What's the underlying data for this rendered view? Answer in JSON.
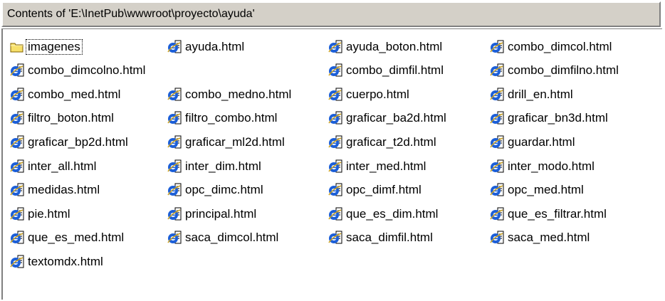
{
  "header": {
    "title": "Contents of 'E:\\InetPub\\wwwroot\\proyecto\\ayuda'"
  },
  "colors": {
    "ie_icon_blue": "#1c5fd8",
    "folder_yellow": "#f7e06a"
  },
  "files": [
    {
      "name": "imagenes",
      "icon": "folder-icon",
      "selected": true
    },
    {
      "name": "ayuda.html",
      "icon": "ie-html-icon"
    },
    {
      "name": "ayuda_boton.html",
      "icon": "ie-html-icon"
    },
    {
      "name": "combo_dimcol.html",
      "icon": "ie-html-icon"
    },
    {
      "name": "combo_dimcolno.html",
      "icon": "ie-html-icon"
    },
    {
      "name": "combo_dimfil.html",
      "icon": "ie-html-icon"
    },
    {
      "name": "combo_dimfilno.html",
      "icon": "ie-html-icon"
    },
    {
      "name": "combo_med.html",
      "icon": "ie-html-icon"
    },
    {
      "name": "combo_medno.html",
      "icon": "ie-html-icon"
    },
    {
      "name": "cuerpo.html",
      "icon": "ie-html-icon"
    },
    {
      "name": "drill_en.html",
      "icon": "ie-html-icon"
    },
    {
      "name": "filtro_boton.html",
      "icon": "ie-html-icon"
    },
    {
      "name": "filtro_combo.html",
      "icon": "ie-html-icon"
    },
    {
      "name": "graficar_ba2d.html",
      "icon": "ie-html-icon"
    },
    {
      "name": "graficar_bn3d.html",
      "icon": "ie-html-icon"
    },
    {
      "name": "graficar_bp2d.html",
      "icon": "ie-html-icon"
    },
    {
      "name": "graficar_ml2d.html",
      "icon": "ie-html-icon"
    },
    {
      "name": "graficar_t2d.html",
      "icon": "ie-html-icon"
    },
    {
      "name": "guardar.html",
      "icon": "ie-html-icon"
    },
    {
      "name": "inter_all.html",
      "icon": "ie-html-icon"
    },
    {
      "name": "inter_dim.html",
      "icon": "ie-html-icon"
    },
    {
      "name": "inter_med.html",
      "icon": "ie-html-icon"
    },
    {
      "name": "inter_modo.html",
      "icon": "ie-html-icon"
    },
    {
      "name": "medidas.html",
      "icon": "ie-html-icon"
    },
    {
      "name": "opc_dimc.html",
      "icon": "ie-html-icon"
    },
    {
      "name": "opc_dimf.html",
      "icon": "ie-html-icon"
    },
    {
      "name": "opc_med.html",
      "icon": "ie-html-icon"
    },
    {
      "name": "pie.html",
      "icon": "ie-html-icon"
    },
    {
      "name": "principal.html",
      "icon": "ie-html-icon"
    },
    {
      "name": "que_es_dim.html",
      "icon": "ie-html-icon"
    },
    {
      "name": "que_es_filtrar.html",
      "icon": "ie-html-icon"
    },
    {
      "name": "que_es_med.html",
      "icon": "ie-html-icon"
    },
    {
      "name": "saca_dimcol.html",
      "icon": "ie-html-icon"
    },
    {
      "name": "saca_dimfil.html",
      "icon": "ie-html-icon"
    },
    {
      "name": "saca_med.html",
      "icon": "ie-html-icon"
    },
    {
      "name": "textomdx.html",
      "icon": "ie-html-icon"
    }
  ]
}
